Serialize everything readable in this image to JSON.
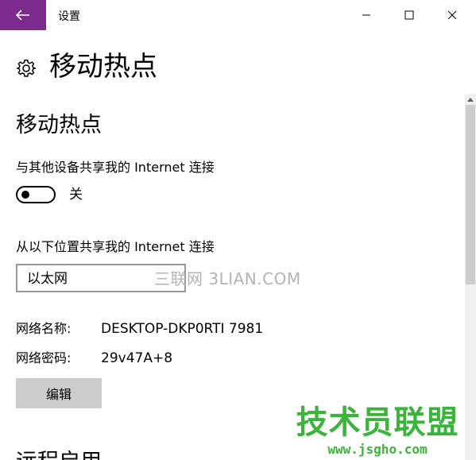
{
  "window": {
    "title": "设置",
    "accent_color": "#7a2b8c"
  },
  "page": {
    "title": "移动热点",
    "icon": "gear-icon"
  },
  "hotspot": {
    "section_title": "移动热点",
    "share_label": "与其他设备共享我的 Internet 连接",
    "toggle_state": "关",
    "share_from_label": "从以下位置共享我的 Internet 连接",
    "share_from_value": "以太网",
    "network_name_label": "网络名称:",
    "network_name": "DESKTOP-DKP0RTI 7981",
    "network_password_label": "网络密码:",
    "network_password": "29v47A+8",
    "edit_button": "编辑"
  },
  "next_section_title": "远程启用",
  "watermarks": {
    "overlay": "三联网 3LIAN.COM",
    "brand_name": "技术员联盟",
    "brand_url": "www.jsgho.com"
  }
}
